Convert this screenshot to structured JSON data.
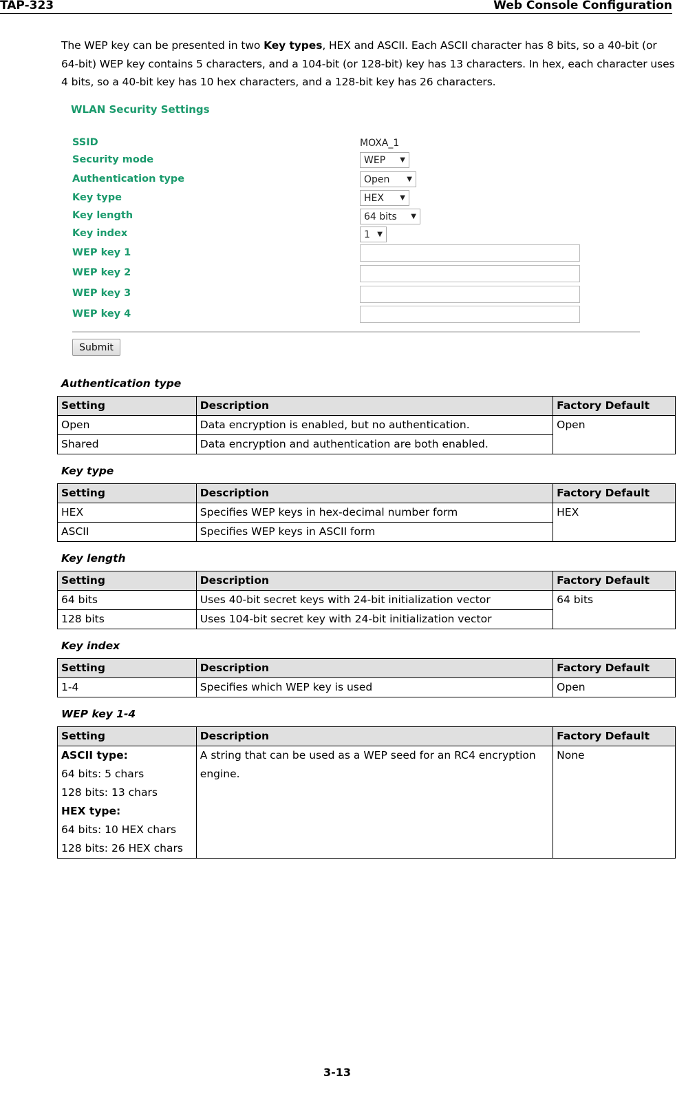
{
  "header": {
    "left": "TAP-323",
    "right": "Web Console Configuration"
  },
  "intro": {
    "before_bold": "The WEP key can be presented in two ",
    "bold": "Key types",
    "after_bold": ", HEX and ASCII. Each ASCII character has 8 bits, so a 40-bit (or 64-bit) WEP key contains 5 characters, and a 104-bit (or 128-bit) key has 13 characters. In hex, each character uses 4 bits, so a 40-bit key has 10 hex characters, and a 128-bit key has 26 characters."
  },
  "console": {
    "title": "WLAN Security Settings",
    "accent_color": "#1a9a6c",
    "fields": {
      "ssid": {
        "label": "SSID",
        "value": "MOXA_1"
      },
      "security_mode": {
        "label": "Security mode",
        "value": "WEP"
      },
      "auth_type": {
        "label": "Authentication type",
        "value": "Open"
      },
      "key_type": {
        "label": "Key type",
        "value": "HEX"
      },
      "key_length": {
        "label": "Key length",
        "value": "64 bits"
      },
      "key_index": {
        "label": "Key index",
        "value": "1"
      },
      "wep_key_1": {
        "label": "WEP key 1",
        "value": ""
      },
      "wep_key_2": {
        "label": "WEP key 2",
        "value": ""
      },
      "wep_key_3": {
        "label": "WEP key 3",
        "value": ""
      },
      "wep_key_4": {
        "label": "WEP key 4",
        "value": ""
      }
    },
    "dropdown_arrow": "▼",
    "submit_label": "Submit"
  },
  "table_headers": {
    "setting": "Setting",
    "description": "Description",
    "default": "Factory Default"
  },
  "tables": {
    "auth": {
      "title": "Authentication type",
      "rows": [
        {
          "setting": "Open",
          "description": "Data encryption is enabled, but no authentication."
        },
        {
          "setting": "Shared",
          "description": "Data encryption and authentication are both enabled."
        }
      ],
      "default": "Open"
    },
    "key_type": {
      "title": "Key type",
      "rows": [
        {
          "setting": "HEX",
          "description": "Specifies WEP keys in hex-decimal number form"
        },
        {
          "setting": "ASCII",
          "description": "Specifies WEP keys in ASCII form"
        }
      ],
      "default": "HEX"
    },
    "key_length": {
      "title": "Key length",
      "rows": [
        {
          "setting": "64 bits",
          "description": "Uses 40-bit secret keys with 24-bit initialization vector"
        },
        {
          "setting": "128 bits",
          "description": "Uses 104-bit secret key with 24-bit initialization vector"
        }
      ],
      "default": "64 bits"
    },
    "key_index": {
      "title": "Key index",
      "rows": [
        {
          "setting": "1-4",
          "description": "Specifies which WEP key is used",
          "default": "Open"
        }
      ]
    },
    "wep_key": {
      "title": "WEP key 1-4",
      "setting_lines": {
        "ascii_heading": "ASCII type:",
        "ascii_64": "64 bits: 5 chars",
        "ascii_128": "128 bits: 13 chars",
        "hex_heading": "HEX type:",
        "hex_64": "64 bits: 10 HEX chars",
        "hex_128": "128 bits: 26 HEX chars"
      },
      "description": "A string that can be used as a WEP seed for an RC4 encryption engine.",
      "default": "None"
    }
  },
  "footer": {
    "page_number": "3-13"
  }
}
